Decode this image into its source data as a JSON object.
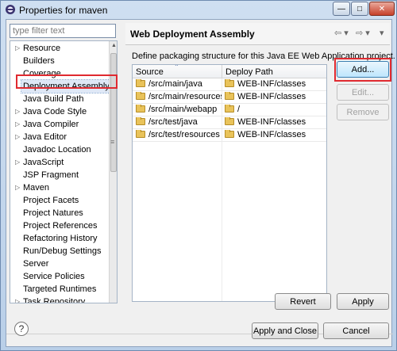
{
  "window": {
    "title": "Properties for maven",
    "minimize": "—",
    "maximize": "□",
    "close": "✕"
  },
  "filter": {
    "placeholder": "type filter text"
  },
  "tree": {
    "items": [
      {
        "label": "Resource",
        "expandable": true
      },
      {
        "label": "Builders",
        "expandable": false
      },
      {
        "label": "Coverage",
        "expandable": false
      },
      {
        "label": "Deployment Assembly",
        "expandable": false,
        "selected": true
      },
      {
        "label": "Java Build Path",
        "expandable": false
      },
      {
        "label": "Java Code Style",
        "expandable": true
      },
      {
        "label": "Java Compiler",
        "expandable": true
      },
      {
        "label": "Java Editor",
        "expandable": true
      },
      {
        "label": "Javadoc Location",
        "expandable": false
      },
      {
        "label": "JavaScript",
        "expandable": true
      },
      {
        "label": "JSP Fragment",
        "expandable": false
      },
      {
        "label": "Maven",
        "expandable": true
      },
      {
        "label": "Project Facets",
        "expandable": false
      },
      {
        "label": "Project Natures",
        "expandable": false
      },
      {
        "label": "Project References",
        "expandable": false
      },
      {
        "label": "Refactoring History",
        "expandable": false
      },
      {
        "label": "Run/Debug Settings",
        "expandable": false
      },
      {
        "label": "Server",
        "expandable": false
      },
      {
        "label": "Service Policies",
        "expandable": false
      },
      {
        "label": "Targeted Runtimes",
        "expandable": false
      },
      {
        "label": "Task Repository",
        "expandable": true
      }
    ]
  },
  "page": {
    "title": "Web Deployment Assembly",
    "description": "Define packaging structure for this Java EE Web Application project.",
    "nav_back": "⇦ ▾",
    "nav_forward": "⇨ ▾",
    "nav_menu": "▾"
  },
  "table": {
    "headers": {
      "source": "Source",
      "deploy": "Deploy Path"
    },
    "rows": [
      {
        "source": "/src/main/java",
        "deploy": "WEB-INF/classes"
      },
      {
        "source": "/src/main/resources",
        "deploy": "WEB-INF/classes"
      },
      {
        "source": "/src/main/webapp",
        "deploy": "/"
      },
      {
        "source": "/src/test/java",
        "deploy": "WEB-INF/classes"
      },
      {
        "source": "/src/test/resources",
        "deploy": "WEB-INF/classes"
      }
    ]
  },
  "buttons": {
    "add": "Add...",
    "edit": "Edit...",
    "remove": "Remove",
    "revert": "Revert",
    "apply": "Apply",
    "apply_close": "Apply and Close",
    "cancel": "Cancel",
    "help": "?"
  },
  "colors": {
    "highlight_red": "#e02a30",
    "selection_bg": "#dfe8f6"
  }
}
